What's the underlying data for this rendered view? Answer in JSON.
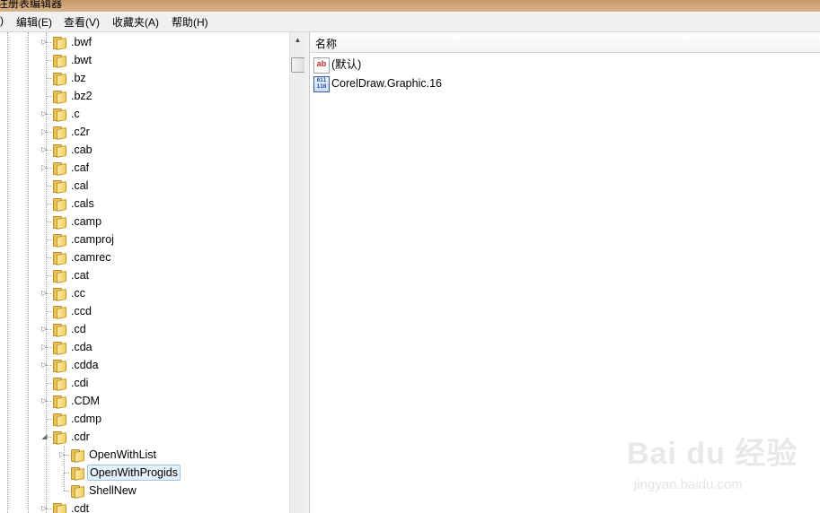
{
  "window": {
    "title": "注册表编辑器"
  },
  "menubar": {
    "leading": ")",
    "items": [
      "编辑(E)",
      "查看(V)",
      "收藏夹(A)",
      "帮助(H)"
    ]
  },
  "tree": {
    "nodes": [
      {
        "label": ".bwf",
        "expandable": true,
        "expanded": false
      },
      {
        "label": ".bwt",
        "expandable": false
      },
      {
        "label": ".bz",
        "expandable": false
      },
      {
        "label": ".bz2",
        "expandable": false
      },
      {
        "label": ".c",
        "expandable": true,
        "expanded": false
      },
      {
        "label": ".c2r",
        "expandable": true,
        "expanded": false
      },
      {
        "label": ".cab",
        "expandable": true,
        "expanded": false
      },
      {
        "label": ".caf",
        "expandable": true,
        "expanded": false
      },
      {
        "label": ".cal",
        "expandable": false
      },
      {
        "label": ".cals",
        "expandable": false
      },
      {
        "label": ".camp",
        "expandable": false
      },
      {
        "label": ".camproj",
        "expandable": false
      },
      {
        "label": ".camrec",
        "expandable": false
      },
      {
        "label": ".cat",
        "expandable": false
      },
      {
        "label": ".cc",
        "expandable": true,
        "expanded": false
      },
      {
        "label": ".ccd",
        "expandable": false
      },
      {
        "label": ".cd",
        "expandable": true,
        "expanded": false
      },
      {
        "label": ".cda",
        "expandable": true,
        "expanded": false
      },
      {
        "label": ".cdda",
        "expandable": true,
        "expanded": false
      },
      {
        "label": ".cdi",
        "expandable": false
      },
      {
        "label": ".CDM",
        "expandable": true,
        "expanded": false
      },
      {
        "label": ".cdmp",
        "expandable": false
      },
      {
        "label": ".cdr",
        "expandable": true,
        "expanded": true
      },
      {
        "label": "OpenWithList",
        "expandable": true,
        "expanded": false,
        "child": true
      },
      {
        "label": "OpenWithProgids",
        "expandable": false,
        "child": true,
        "selected": true
      },
      {
        "label": "ShellNew",
        "expandable": false,
        "child": true
      },
      {
        "label": ".cdt",
        "expandable": true,
        "expanded": false
      }
    ]
  },
  "listview": {
    "column_name": "名称",
    "entries": [
      {
        "name": "(默认)",
        "icon": "string-value-icon",
        "icon_text": "ab"
      },
      {
        "name": "CorelDraw.Graphic.16",
        "icon": "binary-value-icon",
        "icon_text": "011\n110"
      }
    ]
  },
  "watermark": {
    "logo": "Bai du 经验",
    "url": "jingyan.baidu.com"
  }
}
